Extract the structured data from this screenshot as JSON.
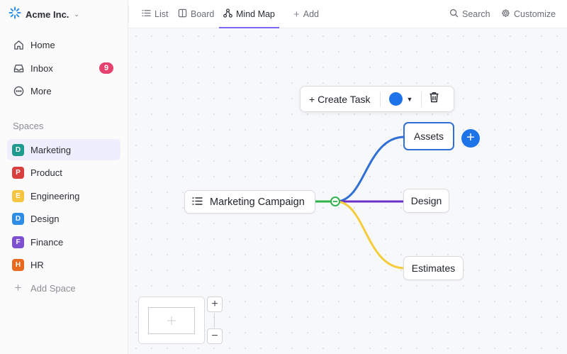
{
  "workspace": {
    "name": "Acme Inc."
  },
  "nav": [
    {
      "label": "Home",
      "icon": "home-icon"
    },
    {
      "label": "Inbox",
      "icon": "inbox-icon",
      "badge": "9"
    },
    {
      "label": "More",
      "icon": "more-icon"
    }
  ],
  "spaces": {
    "label": "Spaces",
    "items": [
      {
        "letter": "D",
        "label": "Marketing",
        "color": "#1f9a8f",
        "active": true
      },
      {
        "letter": "P",
        "label": "Product",
        "color": "#d93f3f"
      },
      {
        "letter": "E",
        "label": "Engineering",
        "color": "#f5c542"
      },
      {
        "letter": "D",
        "label": "Design",
        "color": "#2e8ee6"
      },
      {
        "letter": "F",
        "label": "Finance",
        "color": "#7e4fd1"
      },
      {
        "letter": "H",
        "label": "HR",
        "color": "#e86a1f"
      }
    ],
    "add_label": "Add Space"
  },
  "tabs": [
    {
      "label": "List",
      "icon": "list-icon"
    },
    {
      "label": "Board",
      "icon": "board-icon"
    },
    {
      "label": "Mind Map",
      "icon": "mindmap-icon",
      "active": true
    },
    {
      "label": "Add",
      "icon": "plus-icon"
    }
  ],
  "header_actions": {
    "search": "Search",
    "customize": "Customize"
  },
  "toolbar": {
    "create_task": "+ Create Task",
    "color": "#1f73e8"
  },
  "mindmap": {
    "root": "Marketing Campaign",
    "children": [
      {
        "label": "Assets",
        "color": "#2f6fd6",
        "selected": true
      },
      {
        "label": "Design",
        "color": "#6a2fc7"
      },
      {
        "label": "Estimates",
        "color": "#f5cc3c"
      }
    ],
    "connector_color": "#2fb34a"
  },
  "colors": {
    "accent": "#7b68ee",
    "badge": "#e5426f"
  }
}
